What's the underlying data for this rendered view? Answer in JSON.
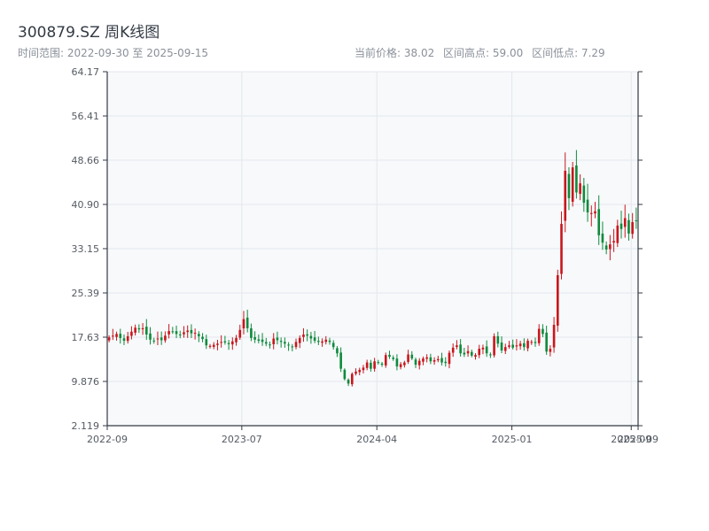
{
  "header": {
    "title": "300879.SZ 周K线图",
    "range_label": "时间范围: 2022-09-30 至 2025-09-15",
    "price_label": "当前价格: 38.02",
    "high_label": "区间高点: 59.00",
    "low_label": "区间低点: 7.29"
  },
  "colors": {
    "up": "#c8171d",
    "down": "#0f8a3c",
    "plot_bg": "#f7f9fb",
    "grid": "#e3e7ec",
    "axis": "#333a44",
    "tick_text": "#555b63"
  },
  "chart_data": {
    "type": "candlestick",
    "title": "300879.SZ 周K线图",
    "xlabel": "",
    "ylabel": "",
    "ylim": [
      2.119,
      64.17
    ],
    "y_ticks": [
      2.119,
      9.876,
      17.63,
      25.39,
      33.15,
      40.9,
      48.66,
      56.41,
      64.17
    ],
    "y_tick_labels": [
      "2.119",
      "9.876",
      "17.63",
      "25.39",
      "33.15",
      "40.90",
      "48.66",
      "56.41",
      "64.17"
    ],
    "x_range": [
      "2022-09-30",
      "2025-09-15"
    ],
    "x_ticks": [
      {
        "date": "2022-09-30",
        "label": "2022-09"
      },
      {
        "date": "2023-07-01",
        "label": "2023-07"
      },
      {
        "date": "2024-04-01",
        "label": "2024-04"
      },
      {
        "date": "2025-01-01",
        "label": "2025-01"
      },
      {
        "date": "2025-09-01",
        "label": "2025-09"
      },
      {
        "date": "2025-09-15",
        "label": "2025-09"
      }
    ],
    "grid": true,
    "legend": "none",
    "summary": {
      "current_price": 38.02,
      "period_high": 59.0,
      "period_low": 7.29
    },
    "weekly_close": [
      17.6,
      17.9,
      18.2,
      17.5,
      17.0,
      17.8,
      18.6,
      19.3,
      19.0,
      19.2,
      18.1,
      17.2,
      17.0,
      17.4,
      17.1,
      17.9,
      18.7,
      18.6,
      18.2,
      18.0,
      18.5,
      18.8,
      18.3,
      18.4,
      17.8,
      17.3,
      16.2,
      16.1,
      16.3,
      16.5,
      16.8,
      16.7,
      16.4,
      16.9,
      17.5,
      18.9,
      20.8,
      19.2,
      17.5,
      17.2,
      17.0,
      16.8,
      16.5,
      16.3,
      17.4,
      17.1,
      16.8,
      16.5,
      16.2,
      16.0,
      16.8,
      17.5,
      18.1,
      17.9,
      17.4,
      17.0,
      16.8,
      16.9,
      17.2,
      16.8,
      15.9,
      14.8,
      12.1,
      10.3,
      9.5,
      11.2,
      11.6,
      11.9,
      12.3,
      13.2,
      12.1,
      13.4,
      13.2,
      12.8,
      14.5,
      14.2,
      13.8,
      12.5,
      12.9,
      13.2,
      14.6,
      13.9,
      12.8,
      13.5,
      13.9,
      14.1,
      13.4,
      13.6,
      13.8,
      13.2,
      13.1,
      14.9,
      15.8,
      16.2,
      14.8,
      14.6,
      15.2,
      14.4,
      14.5,
      15.6,
      15.8,
      14.8,
      14.6,
      17.8,
      16.5,
      15.3,
      15.9,
      16.2,
      15.8,
      16.2,
      16.5,
      15.9,
      17.0,
      16.8,
      16.6,
      19.1,
      18.2,
      15.1,
      15.6,
      19.8,
      28.5,
      37.5,
      46.8,
      42.0,
      47.4,
      43.0,
      44.6,
      41.2,
      39.5,
      39.4,
      39.7,
      35.5,
      34.2,
      33.0,
      33.9,
      34.5,
      37.2,
      36.6,
      38.5,
      35.8,
      37.8,
      38.02
    ]
  }
}
